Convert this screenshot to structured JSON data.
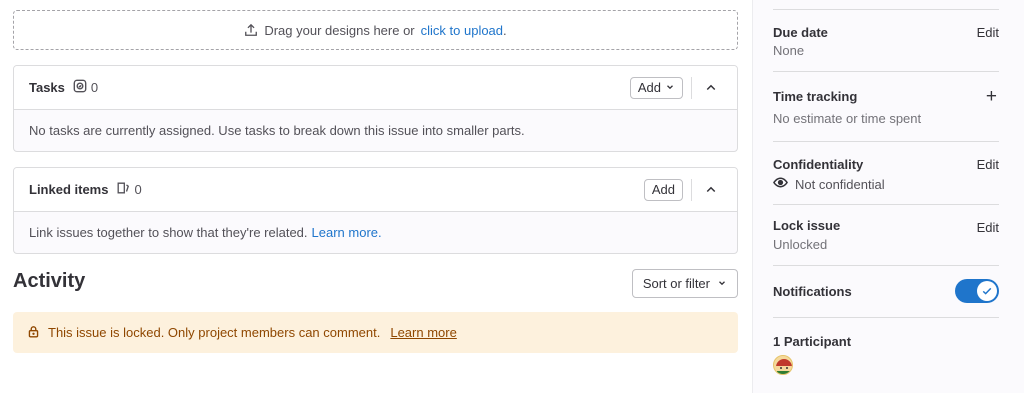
{
  "upload": {
    "icon": "upload-icon",
    "text": "Drag your designs here or",
    "link": "click to upload",
    "suffix": "."
  },
  "tasks": {
    "title": "Tasks",
    "icon": "tasks-icon",
    "count": "0",
    "add_label": "Add",
    "empty_text": "No tasks are currently assigned. Use tasks to break down this issue into smaller parts."
  },
  "linked_items": {
    "title": "Linked items",
    "icon": "linked-items-icon",
    "count": "0",
    "add_label": "Add",
    "empty_text": "Link issues together to show that they're related.",
    "learn_more": "Learn more."
  },
  "activity": {
    "title": "Activity",
    "sort_label": "Sort or filter",
    "alert_text": "This issue is locked. Only project members can comment.",
    "alert_link": "Learn more"
  },
  "sidebar": {
    "due_date": {
      "title": "Due date",
      "value": "None",
      "edit": "Edit"
    },
    "time_tracking": {
      "title": "Time tracking",
      "value": "No estimate or time spent",
      "action": "+"
    },
    "confidentiality": {
      "title": "Confidentiality",
      "value": "Not confidential",
      "edit": "Edit"
    },
    "lock_issue": {
      "title": "Lock issue",
      "value": "Unlocked",
      "edit": "Edit"
    },
    "notifications": {
      "title": "Notifications",
      "enabled": true
    },
    "participants": {
      "title": "1 Participant"
    }
  },
  "colors": {
    "link": "#1f75cb",
    "toggle_on": "#1f75cb",
    "alert_bg": "#fdf1dd",
    "alert_text": "#8f4700"
  }
}
